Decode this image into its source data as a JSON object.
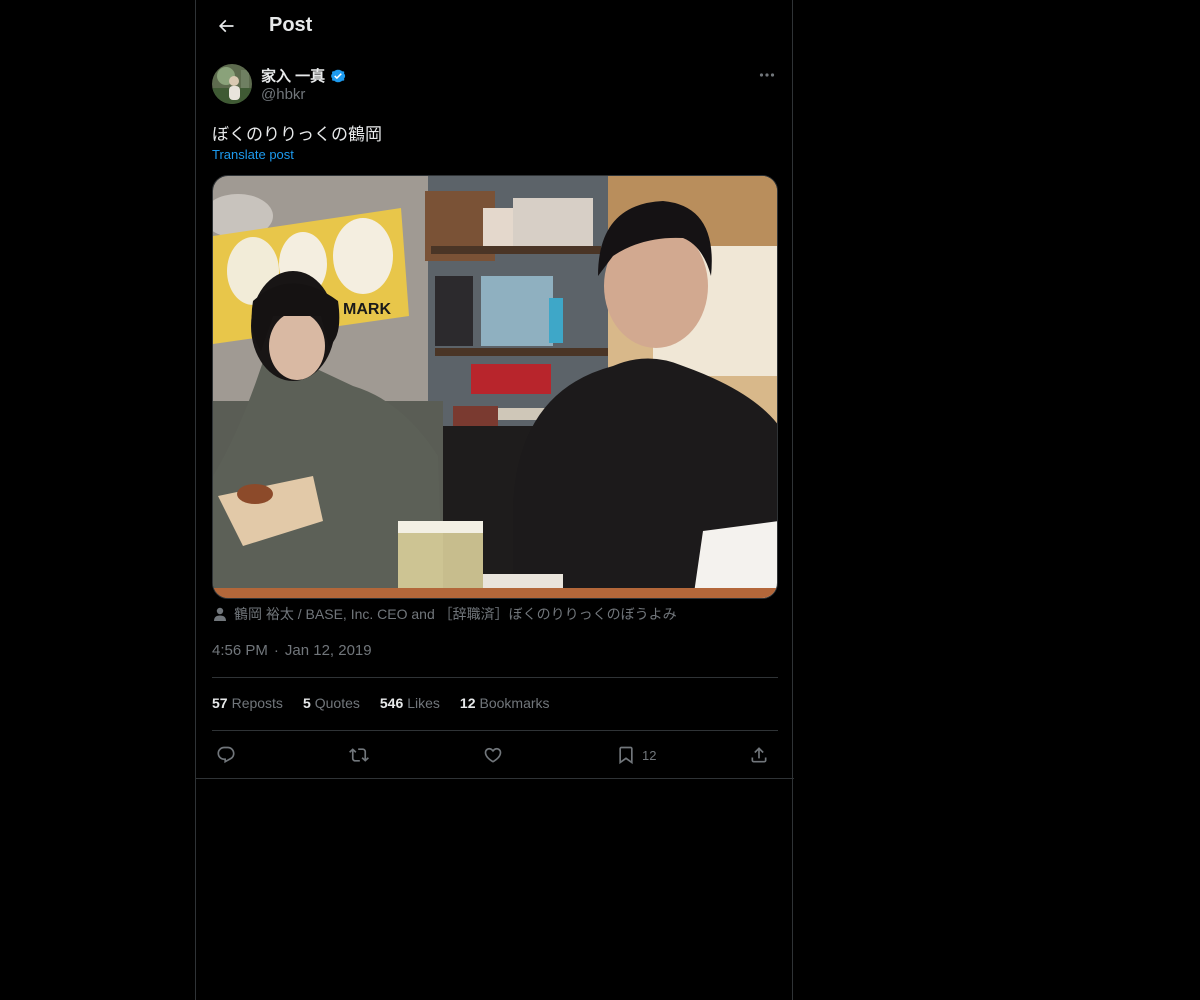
{
  "colors": {
    "background": "#000000",
    "text_primary": "#e7e9ea",
    "text_secondary": "#71767b",
    "accent": "#1d9bf0",
    "border": "#2f3336"
  },
  "header": {
    "back_icon": "arrow-left-icon",
    "title": "Post"
  },
  "author": {
    "display_name": "家入 一真",
    "verified_icon": "verified-badge-icon",
    "handle": "@hbkr",
    "more_icon": "more-horizontal-icon"
  },
  "post": {
    "text": "ぼくのりりっくの鶴岡",
    "translate_label": "Translate post",
    "tagged_icon": "person-icon",
    "tagged": "鶴岡 裕太 / BASE, Inc. CEO and ［辞職済］ぼくのりりっくのぼうよみ",
    "time": "4:56 PM",
    "separator": "·",
    "date": "Jan 12, 2019"
  },
  "stats": [
    {
      "count": "57",
      "label": "Reposts"
    },
    {
      "count": "5",
      "label": "Quotes"
    },
    {
      "count": "546",
      "label": "Likes"
    },
    {
      "count": "12",
      "label": "Bookmarks"
    }
  ],
  "actions": {
    "reply_icon": "reply-icon",
    "repost_icon": "repost-icon",
    "like_icon": "heart-icon",
    "bookmark_icon": "bookmark-icon",
    "bookmark_count": "12",
    "share_icon": "share-icon"
  },
  "photo_sign": "MARK"
}
